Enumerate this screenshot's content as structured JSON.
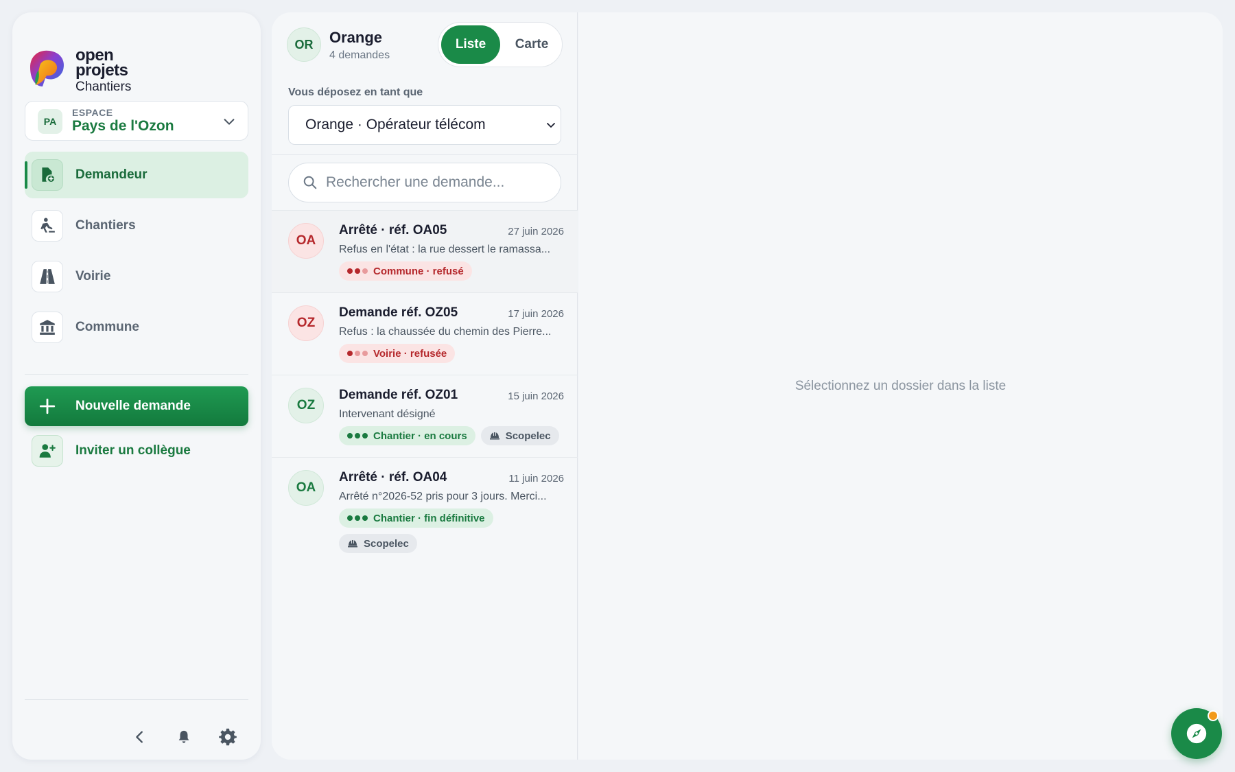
{
  "brand": {
    "line1": "open",
    "line2": "projets",
    "line3": "Chantiers"
  },
  "space": {
    "avatar": "PA",
    "label": "ESPACE",
    "name": "Pays de l'Ozon"
  },
  "nav": [
    {
      "label": "Demandeur",
      "icon": "file-plus-icon",
      "active": true
    },
    {
      "label": "Chantiers",
      "icon": "worker-icon",
      "active": false
    },
    {
      "label": "Voirie",
      "icon": "road-icon",
      "active": false
    },
    {
      "label": "Commune",
      "icon": "bank-icon",
      "active": false
    }
  ],
  "actions": {
    "new_request": "Nouvelle demande",
    "invite": "Inviter un collègue"
  },
  "org": {
    "avatar": "OR",
    "name": "Orange",
    "count": "4 demandes"
  },
  "view_toggle": {
    "list": "Liste",
    "map": "Carte",
    "selected": "Liste"
  },
  "depose": {
    "label": "Vous déposez en tant que",
    "value": "Orange · Opérateur télécom"
  },
  "search": {
    "placeholder": "Rechercher une demande..."
  },
  "requests": [
    {
      "avatar": "OA",
      "tone": "red",
      "title": "Arrêté · réf. OA05",
      "date": "27 juin 2026",
      "desc": "Refus en l'état : la rue dessert le ramassa...",
      "tags": [
        {
          "label": "Commune · refusé",
          "tone": "red",
          "dots": [
            "#b5282c",
            "#b5282c",
            "#e89a9c"
          ]
        }
      ]
    },
    {
      "avatar": "OZ",
      "tone": "red",
      "title": "Demande réf. OZ05",
      "date": "17 juin 2026",
      "desc": "Refus : la chaussée du chemin des Pierre...",
      "tags": [
        {
          "label": "Voirie · refusée",
          "tone": "red",
          "dots": [
            "#b5282c",
            "#e89a9c",
            "#e89a9c"
          ]
        }
      ]
    },
    {
      "avatar": "OZ",
      "tone": "green",
      "title": "Demande réf. OZ01",
      "date": "15 juin 2026",
      "desc": "Intervenant désigné",
      "tags": [
        {
          "label": "Chantier · en cours",
          "tone": "green",
          "dots": [
            "#1a7a40",
            "#1a7a40",
            "#1a7a40"
          ]
        },
        {
          "label": "Scopelec",
          "tone": "gray",
          "icon": "helmet-icon"
        }
      ]
    },
    {
      "avatar": "OA",
      "tone": "green",
      "title": "Arrêté · réf. OA04",
      "date": "11 juin 2026",
      "desc": "Arrêté n°2026-52 pris pour 3 jours. Merci...",
      "tags": [
        {
          "label": "Chantier · fin définitive",
          "tone": "green",
          "dots": [
            "#1a7a40",
            "#1a7a40",
            "#1a7a40"
          ]
        },
        {
          "label": "Scopelec",
          "tone": "gray",
          "icon": "helmet-icon"
        }
      ]
    }
  ],
  "detail": {
    "empty_message": "Sélectionnez un dossier dans la liste"
  },
  "colors": {
    "accent": "#1a8a48",
    "danger": "#b5282c",
    "notification": "#f29a1a"
  }
}
